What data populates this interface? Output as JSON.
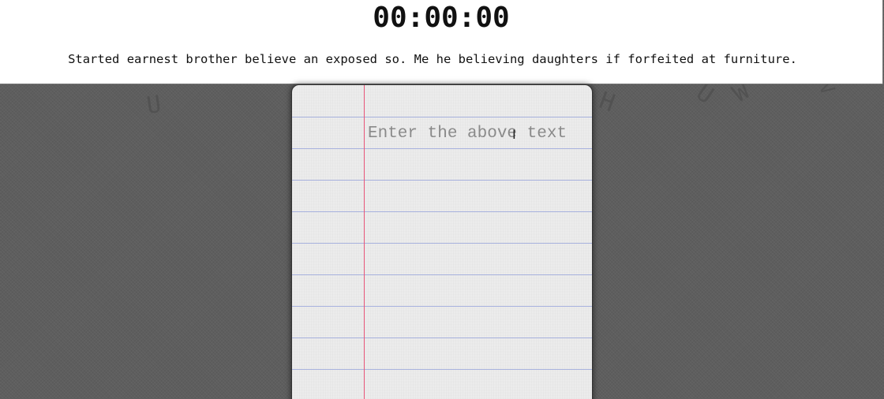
{
  "timer": {
    "display": "00:00:00"
  },
  "prompt": {
    "text": "Started earnest brother believe an exposed so. Me he believing daughters if forfeited at furniture."
  },
  "notebook": {
    "placeholder": "Enter the above text",
    "value": ""
  },
  "colors": {
    "background": "#5e5e5e",
    "header_background": "#ffffff",
    "paper": "#eeeeee",
    "rule_lines": "#aab4e0",
    "margin_line": "#e8567a"
  },
  "icons": {
    "cursor": "text-cursor-icon"
  }
}
